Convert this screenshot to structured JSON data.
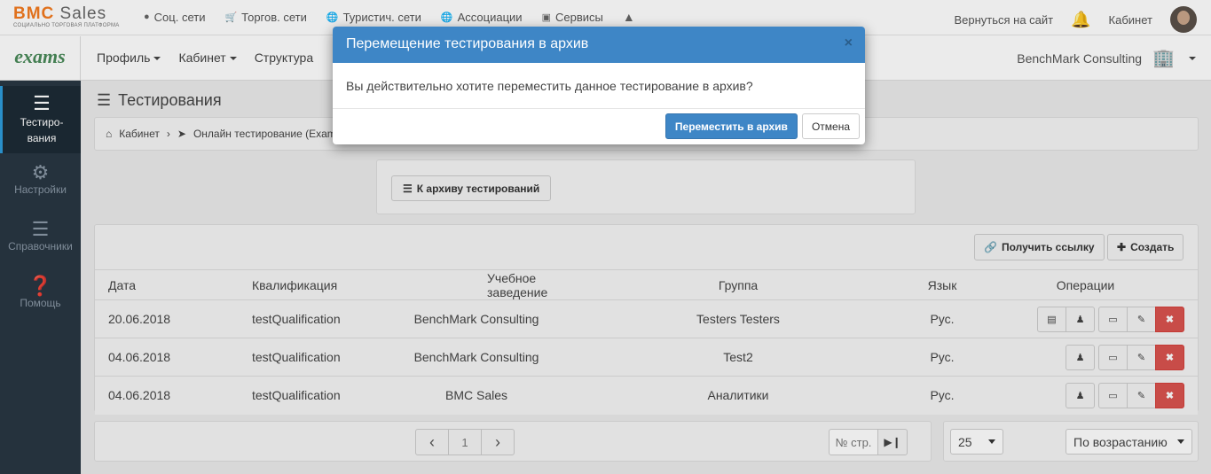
{
  "topbar": {
    "logo_main_1": "BMC",
    "logo_main_2": " Sales",
    "logo_sub": "СОЦИАЛЬНО ТОРГОВАЯ ПЛАТФОРМА",
    "nav": [
      {
        "label": "Соц. сети",
        "icon": "chat-icon"
      },
      {
        "label": "Торгов. сети",
        "icon": "cart-icon"
      },
      {
        "label": "Туристич. сети",
        "icon": "globe-icon"
      },
      {
        "label": "Ассоциации",
        "icon": "globe-icon"
      },
      {
        "label": "Сервисы",
        "icon": "briefcase-icon"
      }
    ],
    "return_label": "Вернуться на сайт",
    "cabinet_label": "Кабинет"
  },
  "navbar": {
    "brand": "exams",
    "items": [
      "Профиль",
      "Кабинет",
      "Структура"
    ],
    "company": "BenchMark Consulting"
  },
  "sidebar": {
    "items": [
      {
        "label": "Тестиро-\nвания",
        "icon": "menu-icon",
        "active": true
      },
      {
        "label": "Настройки",
        "icon": "gear-icon"
      },
      {
        "label": "Справочники",
        "icon": "menu-icon"
      },
      {
        "label": "Помощь",
        "icon": "help-icon"
      }
    ]
  },
  "page": {
    "title": "Тестирования",
    "breadcrumb": [
      "Кабинет",
      "Онлайн тестирование (Exam"
    ],
    "archive_button": "К архиву тестирований",
    "get_link_button": "Получить ссылку",
    "create_button": "Создать"
  },
  "table": {
    "headers": [
      "Дата",
      "Квалификация",
      "Учебное заведение",
      "Группа",
      "Язык",
      "Операции"
    ],
    "rows": [
      {
        "date": "20.06.2018",
        "qualification": "testQualification",
        "institution": "BenchMark Consulting",
        "group": "Testers Testers",
        "lang": "Рус.",
        "stats": true
      },
      {
        "date": "04.06.2018",
        "qualification": "testQualification",
        "institution": "BenchMark Consulting",
        "group": "Test2",
        "lang": "Рус.",
        "stats": false
      },
      {
        "date": "04.06.2018",
        "qualification": "testQualification",
        "institution": "BMC Sales",
        "group": "Аналитики",
        "lang": "Рус.",
        "stats": false
      }
    ]
  },
  "pager": {
    "current": "1",
    "page_placeholder": "№ стр."
  },
  "sort": {
    "per_page": "25",
    "order": "По возрастанию"
  },
  "modal": {
    "title": "Перемещение тестирования в архив",
    "close": "×",
    "body": "Вы действительно хотите переместить данное тестирование в архив?",
    "confirm": "Переместить в архив",
    "cancel": "Отмена"
  },
  "colors": {
    "primary": "#3e86c6",
    "danger": "#d9534f",
    "sidebar": "#293743",
    "accent": "#f47b20"
  }
}
